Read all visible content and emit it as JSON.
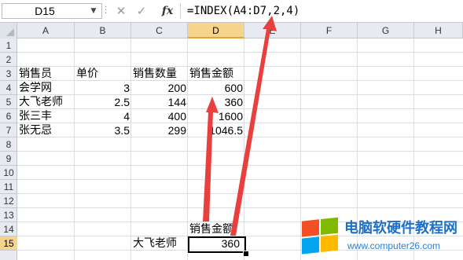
{
  "formula_bar": {
    "name_box": "D15",
    "formula": "=INDEX(A4:D7,2,4)",
    "fx_label": "fx",
    "cancel_icon": "x-icon",
    "enter_icon": "check-icon"
  },
  "columns": [
    "A",
    "B",
    "C",
    "D",
    "E",
    "F",
    "G",
    "H"
  ],
  "active_column": "D",
  "rows": [
    "1",
    "2",
    "3",
    "4",
    "5",
    "6",
    "7",
    "8",
    "9",
    "10",
    "11",
    "12",
    "13",
    "14",
    "15"
  ],
  "active_row": "15",
  "cells": {
    "A3": "销售员",
    "B3": "单价",
    "C3": "销售数量",
    "D3": "销售金额",
    "A4": "会学网",
    "B4": "3",
    "C4": "200",
    "D4": "600",
    "A5": "大飞老师",
    "B5": "2.5",
    "C5": "144",
    "D5": "360",
    "A6": "张三丰",
    "B6": "4",
    "C6": "400",
    "D6": "1600",
    "A7": "张无忌",
    "B7": "3.5",
    "C7": "299",
    "D7": "1046.5",
    "D14": "销售金额",
    "C15": "大飞老师",
    "D15": "360"
  },
  "annotations": {
    "arrow_color": "#e8403e"
  },
  "watermark": {
    "title": "电脑软硬件教程网",
    "url": "www.computer26.com",
    "logo_colors": [
      "#f25022",
      "#7fba00",
      "#00a4ef",
      "#ffb900"
    ]
  }
}
